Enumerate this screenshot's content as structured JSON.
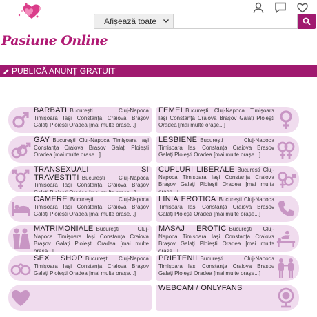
{
  "header": {
    "logo_text": "Pasiune Online",
    "search": {
      "select_value": "Afișează toate",
      "input_placeholder": ""
    },
    "icons": [
      "user-icon",
      "message-icon",
      "heart-icon",
      "search-icon"
    ]
  },
  "post_bar": {
    "label": "PUBLICĂ ANUNȚ GRATUIT",
    "icon": "pencil-icon"
  },
  "categories": [
    {
      "title": "BARBATI",
      "icon": "male-symbol-icon",
      "cities": "București Cluj-Napoca Timișoara Iași Constanța Craiova Brașov Galați Ploiești Oradea",
      "more": "[mai multe orașe...]"
    },
    {
      "title": "FEMEI",
      "icon": "female-symbol-icon",
      "cities": "București Cluj-Napoca Timișoara Iași Constanța Craiova Brașov Galați Ploiești Oradea",
      "more": "[mai multe orașe...]"
    },
    {
      "title": "GAY",
      "icon": "gay-symbol-icon",
      "cities": "București Cluj-Napoca Timișoara Iași Constanța Craiova Brașov Galați Ploiești Oradea",
      "more": "[mai multe orașe...]"
    },
    {
      "title": "LESBIENE",
      "icon": "lesbian-symbol-icon",
      "cities": "București Cluj-Napoca Timișoara Iași Constanța Craiova Brașov Galați Ploiești Oradea",
      "more": "[mai multe orașe...]"
    },
    {
      "title": "TRANSEXUALI SI TRAVESTITI",
      "icon": "transgender-symbol-icon",
      "cities": "București Cluj-Napoca Timișoara Iași Constanța Craiova Brașov Galați Ploiești Oradea",
      "more": "[mai multe orașe...]"
    },
    {
      "title": "CUPLURI LIBERALE",
      "icon": "couples-symbol-icon",
      "cities": "București Cluj-Napoca Timișoara Iași Constanța Craiova Brașov Galați Ploiești Oradea",
      "more": "[mai multe orașe...]"
    },
    {
      "title": "CAMERE",
      "icon": "bed-icon",
      "cities": "București Cluj-Napoca Timișoara Iași Constanța Craiova Brașov Galați Ploiești Oradea",
      "more": "[mai multe orașe...]"
    },
    {
      "title": "LINIA EROTICA",
      "icon": "phone-icon",
      "cities": "București Cluj-Napoca Timișoara Iași Constanța Craiova Brașov Galați Ploiești Oradea",
      "more": "[mai multe orașe...]"
    },
    {
      "title": "MATRIMONIALE",
      "icon": "wedding-couple-icon",
      "cities": "București Cluj-Napoca Timișoara Iași Constanța Craiova Brașov Galați Ploiești Oradea",
      "more": "[mai multe orașe...]"
    },
    {
      "title": "MASAJ EROTIC",
      "icon": "massage-icon",
      "cities": "București Cluj-Napoca Timișoara Iași Constanța Craiova Brașov Galați Ploiești Oradea",
      "more": "[mai multe orașe...]"
    },
    {
      "title": "SEX SHOP",
      "icon": "handcuffs-icon",
      "cities": "București Cluj-Napoca Timișoara Iași Constanța Craiova Brașov Galați Ploiești Oradea",
      "more": "[mai multe orașe...]"
    },
    {
      "title": "PRIETENII",
      "icon": "friends-icon",
      "cities": "București Cluj-Napoca Timișoara Iași Constanța Craiova Brașov Galați Ploiești Oradea",
      "more": "[mai multe orașe...]"
    },
    {
      "title": "",
      "icon": "heart-icon",
      "cities": "",
      "more": ""
    },
    {
      "title": "WEBCAM / ONLYFANS",
      "icon": "webcam-icon",
      "cities": "",
      "more": ""
    }
  ],
  "colors": {
    "brand": "#a0196f",
    "card_bg": "#f0dcee",
    "icon": "#c896c4"
  }
}
